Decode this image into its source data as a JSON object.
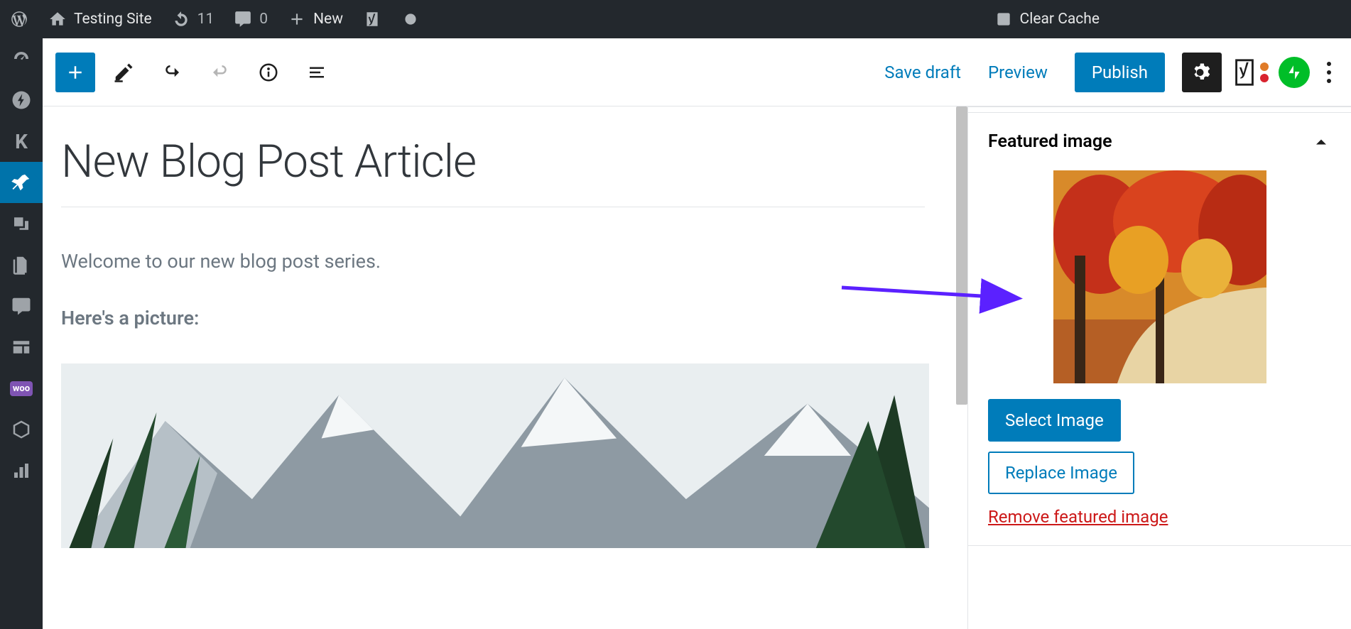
{
  "adminbar": {
    "site_name": "Testing Site",
    "updates_count": "11",
    "comments_count": "0",
    "new_label": "New",
    "clear_cache": "Clear Cache"
  },
  "editor_header": {
    "save_draft": "Save draft",
    "preview": "Preview",
    "publish": "Publish"
  },
  "post": {
    "title": "New Blog Post Article",
    "intro": "Welcome to our new blog post series.",
    "picture_caption": "Here's a picture:"
  },
  "sidebar": {
    "featured_image": {
      "heading": "Featured image",
      "select": "Select Image",
      "replace": "Replace Image",
      "remove": "Remove featured image"
    }
  }
}
